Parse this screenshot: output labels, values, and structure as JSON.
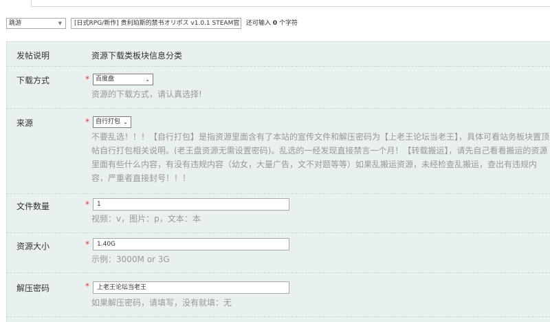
{
  "title_row": {
    "type_select": "跳游",
    "title_value": "[日式RPG/新作] 贵利珀斯的禁书オリポス v1.0.1 STEAM官",
    "hint_prefix": "还可输入",
    "hint_count": "0",
    "hint_suffix": "个字符"
  },
  "form": {
    "post_info": {
      "label": "发帖说明",
      "value": "资源下载类板块信息分类"
    },
    "download": {
      "label": "下载方式",
      "required": "*",
      "selected": "百度盘",
      "tip": "资源的下载方式，请认真选择!"
    },
    "source": {
      "label": "来源",
      "required": "*",
      "selected": "自行打包",
      "tip": "不要乱选！！！【自行打包】是指资源里面含有了本站的宣传文件和解压密码为【上老王论坛当老王】，具体可看站务板块置顶帖自行打包相关说明。(老王盘资源无需设置密码)。乱选的一经发现直接禁言一个月！【转载搬运】，请先自己看看搬运的资源里面有些什么内容，有没有违规内容（幼女，大量广告，文不对题等等）如果乱搬运资源，未经检查乱搬运，查出有违规内容，严重者直接封号！！！"
    },
    "file_count": {
      "label": "文件数量",
      "required": "*",
      "value": "1",
      "tip": "视频：v，图片：p，文本：本"
    },
    "size": {
      "label": "资源大小",
      "required": "*",
      "value": "1.40G",
      "tip": "示例：3000M or 3G"
    },
    "password": {
      "label": "解压密码",
      "required": "*",
      "value": "上老王论坛当老王",
      "tip": "如果解压密码，请填写，没有就填：无"
    }
  }
}
